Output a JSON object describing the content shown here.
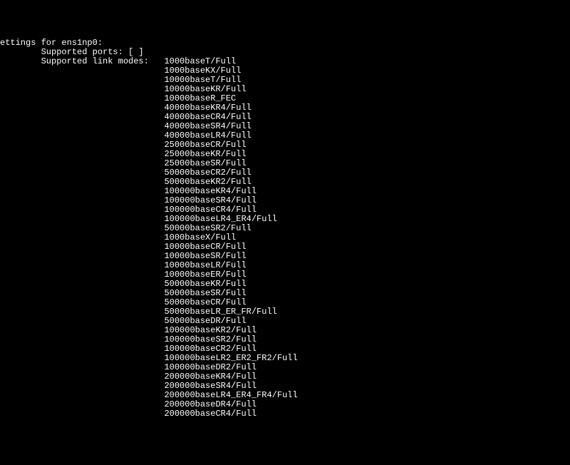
{
  "header": "ettings for ens1np0:",
  "supported_ports_line": "        Supported ports: [ ]",
  "supported_link_modes_label": "        Supported link modes:   ",
  "indent": "                                ",
  "modes": [
    "1000baseT/Full",
    "1000baseKX/Full",
    "10000baseT/Full",
    "10000baseKR/Full",
    "10000baseR_FEC",
    "40000baseKR4/Full",
    "40000baseCR4/Full",
    "40000baseSR4/Full",
    "40000baseLR4/Full",
    "25000baseCR/Full",
    "25000baseKR/Full",
    "25000baseSR/Full",
    "50000baseCR2/Full",
    "50000baseKR2/Full",
    "100000baseKR4/Full",
    "100000baseSR4/Full",
    "100000baseCR4/Full",
    "100000baseLR4_ER4/Full",
    "50000baseSR2/Full",
    "1000baseX/Full",
    "10000baseCR/Full",
    "10000baseSR/Full",
    "10000baseLR/Full",
    "10000baseER/Full",
    "50000baseKR/Full",
    "50000baseSR/Full",
    "50000baseCR/Full",
    "50000baseLR_ER_FR/Full",
    "50000baseDR/Full",
    "100000baseKR2/Full",
    "100000baseSR2/Full",
    "100000baseCR2/Full",
    "100000baseLR2_ER2_FR2/Full",
    "100000baseDR2/Full",
    "200000baseKR4/Full",
    "200000baseSR4/Full",
    "200000baseLR4_ER4_FR4/Full",
    "200000baseDR4/Full",
    "200000baseCR4/Full"
  ]
}
